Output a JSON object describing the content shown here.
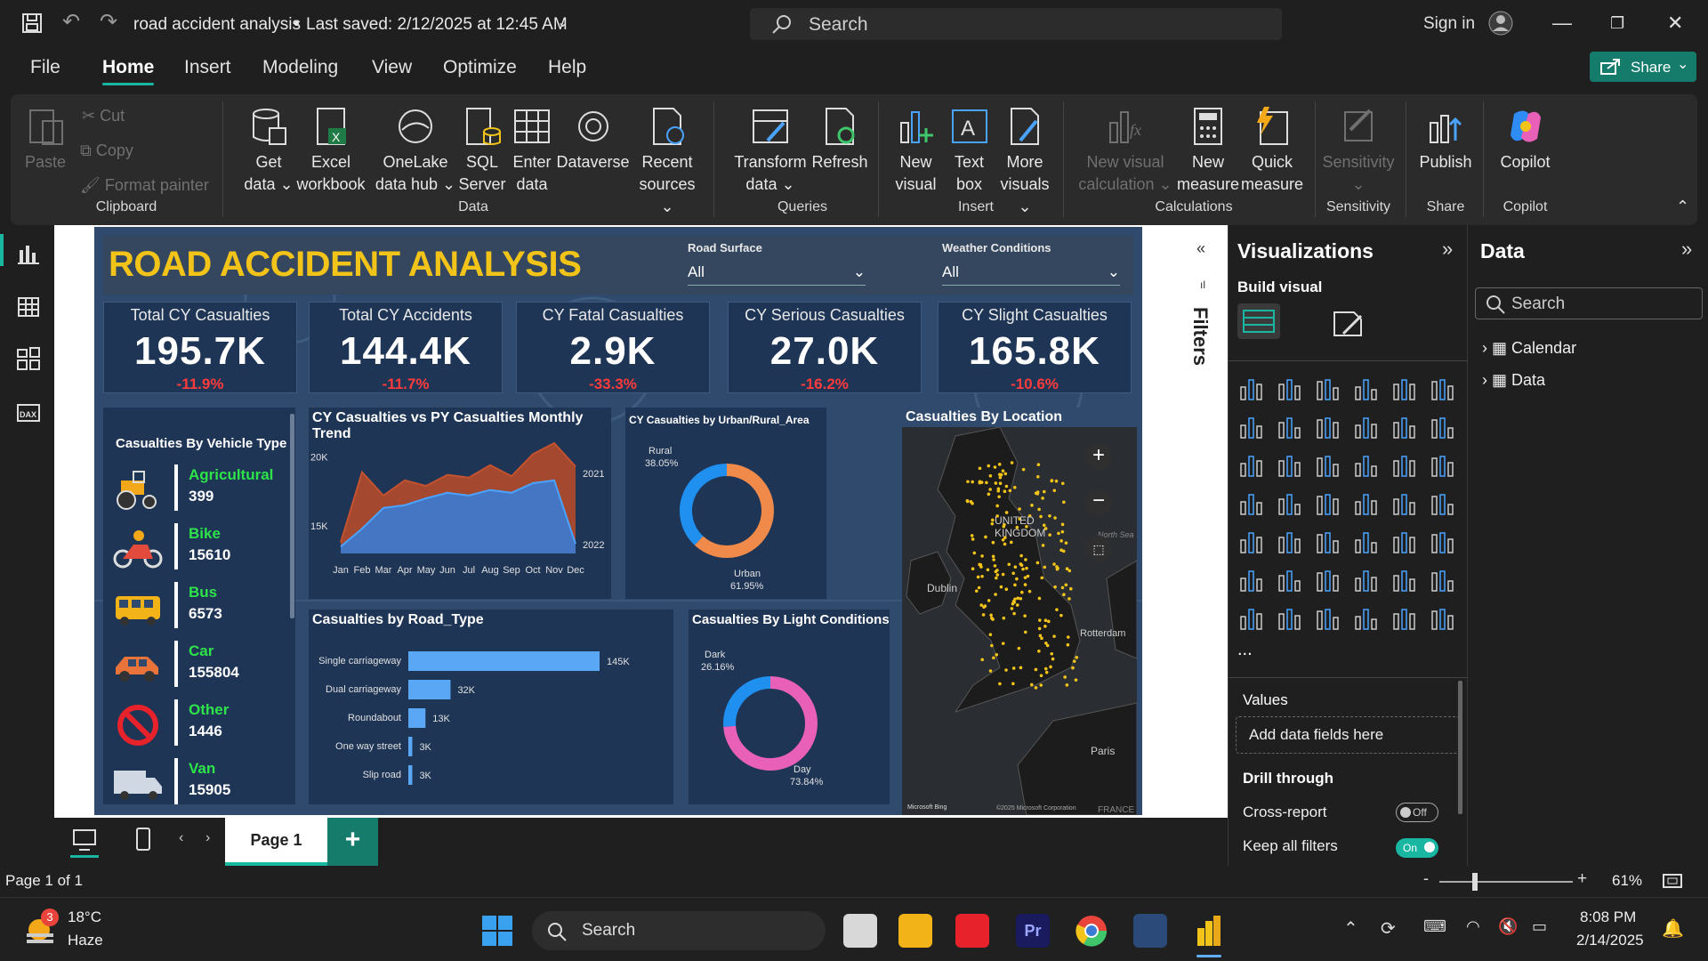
{
  "titlebar": {
    "doc_title": "road accident analysis",
    "saved": "Last saved: 2/12/2025 at 12:45 AM",
    "search_placeholder": "Search",
    "sign_in": "Sign in"
  },
  "menu": {
    "items": [
      "File",
      "Home",
      "Insert",
      "Modeling",
      "View",
      "Optimize",
      "Help"
    ],
    "share": "Share"
  },
  "ribbon": {
    "clipboard": {
      "paste": "Paste",
      "cut": "Cut",
      "copy": "Copy",
      "format_painter": "Format painter",
      "group": "Clipboard"
    },
    "data": {
      "get_data": "Get",
      "get_data2": "data",
      "excel": "Excel",
      "excel2": "workbook",
      "onelake": "OneLake",
      "onelake2": "data hub",
      "sql": "SQL",
      "sql2": "Server",
      "enter": "Enter",
      "enter2": "data",
      "dataverse": "Dataverse",
      "recent": "Recent",
      "recent2": "sources",
      "group": "Data"
    },
    "queries": {
      "transform": "Transform",
      "transform2": "data",
      "refresh": "Refresh",
      "group": "Queries"
    },
    "insert": {
      "new_visual": "New",
      "new_visual2": "visual",
      "text_box": "Text",
      "text_box2": "box",
      "more": "More",
      "more2": "visuals",
      "group": "Insert"
    },
    "calculations": {
      "nvc": "New visual",
      "nvc2": "calculation",
      "nm": "New",
      "nm2": "measure",
      "qm": "Quick",
      "qm2": "measure",
      "group": "Calculations"
    },
    "sensitivity": {
      "label": "Sensitivity",
      "group": "Sensitivity"
    },
    "share": {
      "publish": "Publish",
      "group": "Share"
    },
    "copilot": {
      "label": "Copilot",
      "group": "Copilot"
    }
  },
  "report": {
    "title": "ROAD ACCIDENT ANALYSIS",
    "slicers": [
      {
        "label": "Road Surface",
        "value": "All"
      },
      {
        "label": "Weather Conditions",
        "value": "All"
      }
    ],
    "kpis": [
      {
        "label": "Total CY Casualties",
        "value": "195.7K",
        "change": "-11.9%"
      },
      {
        "label": "Total CY Accidents",
        "value": "144.4K",
        "change": "-11.7%"
      },
      {
        "label": "CY Fatal Casualties",
        "value": "2.9K",
        "change": "-33.3%"
      },
      {
        "label": "CY Serious Casualties",
        "value": "27.0K",
        "change": "-16.2%"
      },
      {
        "label": "CY Slight Casualties",
        "value": "165.8K",
        "change": "-10.6%"
      }
    ],
    "vehicle_panel": {
      "title": "Casualties By Vehicle Type",
      "items": [
        {
          "name": "Agricultural",
          "value": "399"
        },
        {
          "name": "Bike",
          "value": "15610"
        },
        {
          "name": "Bus",
          "value": "6573"
        },
        {
          "name": "Car",
          "value": "155804"
        },
        {
          "name": "Other",
          "value": "1446"
        },
        {
          "name": "Van",
          "value": "15905"
        }
      ]
    },
    "trend_title": "CY Casualties vs PY Casualties Monthly Trend",
    "urban_title": "CY Casualties by Urban/Rural_Area",
    "location_title": "Casualties By Location",
    "road_title": "Casualties by Road_Type",
    "light_title": "Casualties By Light Conditions",
    "map_labels": {
      "uk": "UNITED",
      "uk2": "KINGDOM",
      "dublin": "Dublin",
      "paris": "Paris",
      "rotterdam": "Rotterdam",
      "bing": "Microsoft Bing",
      "copyright": "©2025 Microsoft Corporation",
      "north_sea": "North Sea",
      "france": "FRANCE"
    }
  },
  "chart_data": [
    {
      "type": "area",
      "title": "CY Casualties vs PY Casualties Monthly Trend",
      "x": [
        "Jan",
        "Feb",
        "Mar",
        "Apr",
        "May",
        "Jun",
        "Jul",
        "Aug",
        "Sep",
        "Oct",
        "Nov",
        "Dec"
      ],
      "ylim": [
        13000,
        21000
      ],
      "yticks": [
        "15K",
        "20K"
      ],
      "series": [
        {
          "name": "2021",
          "color": "#b24a2c",
          "values": [
            13800,
            18900,
            17200,
            18300,
            17900,
            18700,
            18500,
            19400,
            18600,
            20200,
            21000,
            19300
          ]
        },
        {
          "name": "2022",
          "color": "#3a7bd5",
          "values": [
            13500,
            14800,
            16300,
            16500,
            17000,
            17400,
            17200,
            17600,
            17400,
            18100,
            18300,
            13700
          ]
        }
      ]
    },
    {
      "type": "pie",
      "title": "CY Casualties by Urban/Rural_Area",
      "categories": [
        "Rural",
        "Urban"
      ],
      "values": [
        38.05,
        61.95
      ],
      "labels": [
        "38.05%",
        "61.95%"
      ],
      "colors": [
        "#1f8ff0",
        "#f08a4b"
      ]
    },
    {
      "type": "bar",
      "title": "Casualties by Road_Type",
      "categories": [
        "Single carriageway",
        "Dual carriageway",
        "Roundabout",
        "One way street",
        "Slip road"
      ],
      "values": [
        145,
        32,
        13,
        3,
        3
      ],
      "labels": [
        "145K",
        "32K",
        "13K",
        "3K",
        "3K"
      ],
      "color": "#5aa8f5"
    },
    {
      "type": "pie",
      "title": "Casualties By Light Conditions",
      "categories": [
        "Dark",
        "Day"
      ],
      "values": [
        26.16,
        73.84
      ],
      "labels": [
        "26.16%",
        "73.84%"
      ],
      "colors": [
        "#1f8ff0",
        "#e960b9"
      ]
    }
  ],
  "filters": {
    "label": "Filters"
  },
  "viz_pane": {
    "title": "Visualizations",
    "build": "Build visual",
    "values": "Values",
    "add_fields": "Add data fields here",
    "drill": "Drill through",
    "cross_report": "Cross-report",
    "cross_state": "Off",
    "keep_filters": "Keep all filters",
    "keep_state": "On",
    "more": "..."
  },
  "data_pane": {
    "title": "Data",
    "search": "Search",
    "tables": [
      "Calendar",
      "Data"
    ]
  },
  "pages": {
    "current": "Page 1",
    "add": "+"
  },
  "status": {
    "page": "Page 1 of 1",
    "zoom": "61%",
    "minus": "-",
    "plus": "+"
  },
  "taskbar": {
    "weather_temp": "18°C",
    "weather_desc": "Haze",
    "badge": "3",
    "search": "Search",
    "time": "8:08 PM",
    "date": "2/14/2025"
  }
}
